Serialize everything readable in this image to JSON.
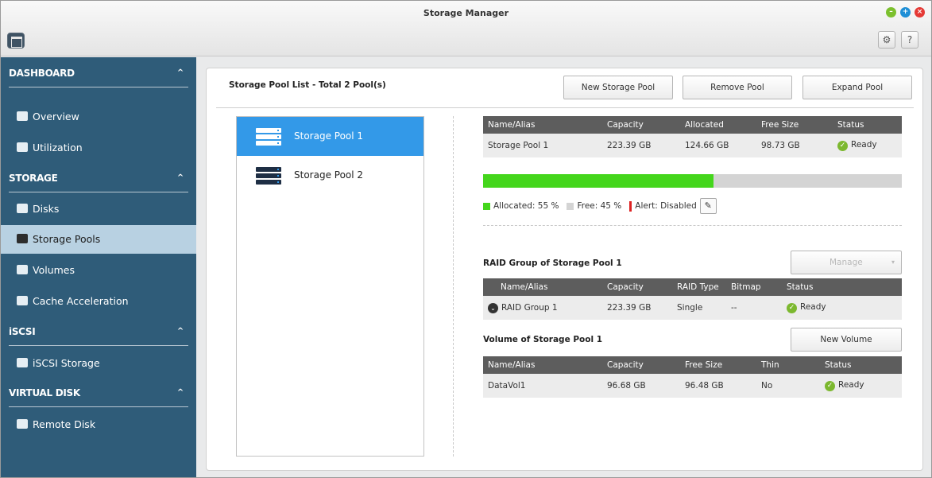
{
  "window": {
    "title": "Storage Manager",
    "settings_icon": "gear-icon",
    "help_label": "?"
  },
  "sidebar": {
    "sections": [
      {
        "title": "DASHBOARD",
        "items": [
          "Overview",
          "Utilization"
        ]
      },
      {
        "title": "STORAGE",
        "items": [
          "Disks",
          "Storage Pools",
          "Volumes",
          "Cache Acceleration"
        ]
      },
      {
        "title": "iSCSI",
        "items": [
          "iSCSI Storage"
        ]
      },
      {
        "title": "VIRTUAL DISK",
        "items": [
          "Remote Disk"
        ]
      }
    ],
    "active_item": "Storage Pools"
  },
  "main": {
    "pool_list_title": "Storage Pool List - Total 2 Pool(s)",
    "buttons": {
      "new_pool": "New Storage Pool",
      "remove_pool": "Remove Pool",
      "expand_pool": "Expand Pool"
    },
    "pools": [
      "Storage Pool 1",
      "Storage Pool 2"
    ],
    "selected_pool": "Storage Pool 1"
  },
  "pool_table": {
    "headers": [
      "Name/Alias",
      "Capacity",
      "Allocated",
      "Free Size",
      "Status"
    ],
    "row": {
      "name": "Storage Pool 1",
      "capacity": "223.39 GB",
      "allocated": "124.66 GB",
      "free": "98.73 GB",
      "status": "Ready"
    }
  },
  "usage": {
    "allocated_fraction": 0.55,
    "allocated_label": "Allocated: 55 %",
    "free_label": "Free: 45 %",
    "alert_label": "Alert: Disabled",
    "allocated_color": "#44d61c",
    "free_color": "#d4d4d4"
  },
  "raid": {
    "title": "RAID Group of Storage Pool 1",
    "manage_label": "Manage",
    "headers": [
      "Name/Alias",
      "Capacity",
      "RAID Type",
      "Bitmap",
      "Status"
    ],
    "row": {
      "name": "RAID Group 1",
      "capacity": "223.39 GB",
      "type": "Single",
      "bitmap": "--",
      "status": "Ready"
    }
  },
  "volumes": {
    "title": "Volume of Storage Pool 1",
    "new_volume_label": "New Volume",
    "headers": [
      "Name/Alias",
      "Capacity",
      "Free Size",
      "Thin",
      "Status"
    ],
    "row": {
      "name": "DataVol1",
      "capacity": "96.68 GB",
      "free": "96.48 GB",
      "thin": "No",
      "status": "Ready"
    }
  }
}
